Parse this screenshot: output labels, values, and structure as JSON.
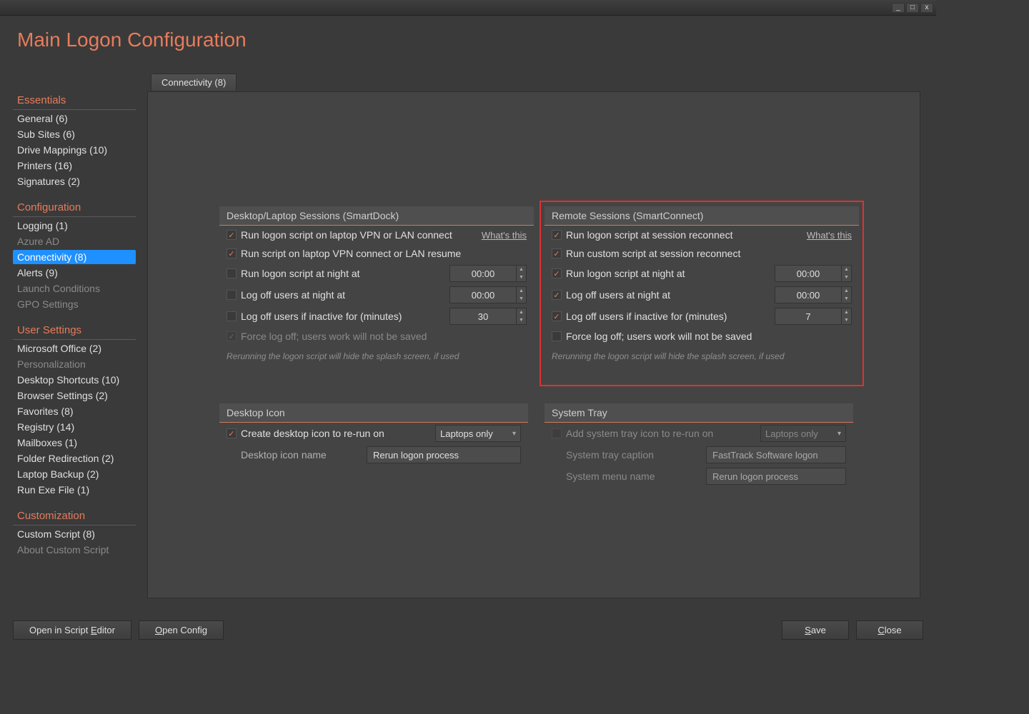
{
  "page_title": "Main Logon Configuration",
  "titlebar": {
    "min": "_",
    "max": "□",
    "close": "x"
  },
  "sidebar": {
    "sections": [
      {
        "title": "Essentials",
        "items": [
          {
            "label": "General (6)"
          },
          {
            "label": "Sub Sites (6)"
          },
          {
            "label": "Drive Mappings (10)"
          },
          {
            "label": "Printers (16)"
          },
          {
            "label": "Signatures (2)"
          }
        ]
      },
      {
        "title": "Configuration",
        "items": [
          {
            "label": "Logging (1)"
          },
          {
            "label": "Azure AD",
            "dim": true
          },
          {
            "label": "Connectivity (8)",
            "selected": true
          },
          {
            "label": "Alerts (9)"
          },
          {
            "label": "Launch Conditions",
            "dim": true
          },
          {
            "label": "GPO Settings",
            "dim": true
          }
        ]
      },
      {
        "title": "User Settings",
        "items": [
          {
            "label": "Microsoft Office (2)"
          },
          {
            "label": "Personalization",
            "dim": true
          },
          {
            "label": "Desktop Shortcuts (10)"
          },
          {
            "label": "Browser Settings (2)"
          },
          {
            "label": "Favorites (8)"
          },
          {
            "label": "Registry (14)"
          },
          {
            "label": "Mailboxes (1)"
          },
          {
            "label": "Folder Redirection (2)"
          },
          {
            "label": "Laptop Backup (2)"
          },
          {
            "label": "Run Exe File (1)"
          }
        ]
      },
      {
        "title": "Customization",
        "items": [
          {
            "label": "Custom Script (8)"
          },
          {
            "label": "About Custom Script",
            "dim": true
          }
        ]
      }
    ]
  },
  "tab_label": "Connectivity (8)",
  "groups": {
    "desktop": {
      "title": "Desktop/Laptop Sessions (SmartDock)",
      "whats_this": "What's this",
      "rows": {
        "r1": {
          "checked": true,
          "label": "Run logon script on laptop VPN or LAN connect"
        },
        "r2": {
          "checked": true,
          "label": "Run script on laptop VPN connect or LAN resume"
        },
        "r3": {
          "checked": false,
          "label": "Run logon script at night at",
          "value": "00:00"
        },
        "r4": {
          "checked": false,
          "label": "Log off users at night at",
          "value": "00:00"
        },
        "r5": {
          "checked": false,
          "label": "Log off users if inactive for (minutes)",
          "value": "30"
        },
        "r6": {
          "checked": true,
          "dim": true,
          "label": "Force log off; users work will not be saved"
        }
      },
      "hint": "Rerunning the logon script will hide the splash screen, if used"
    },
    "remote": {
      "title": "Remote Sessions (SmartConnect)",
      "whats_this": "What's this",
      "rows": {
        "r1": {
          "checked": true,
          "label": "Run logon script at session reconnect"
        },
        "r2": {
          "checked": true,
          "label": "Run custom script at session reconnect"
        },
        "r3": {
          "checked": true,
          "label": "Run logon script at night at",
          "value": "00:00"
        },
        "r4": {
          "checked": true,
          "label": "Log off users at night at",
          "value": "00:00"
        },
        "r5": {
          "checked": true,
          "label": "Log off users if inactive for (minutes)",
          "value": "7"
        },
        "r6": {
          "checked": false,
          "label": "Force log off; users work will not be saved"
        }
      },
      "hint": "Rerunning the logon script will hide the splash screen, if used"
    },
    "desktop_icon": {
      "title": "Desktop Icon",
      "r1": {
        "checked": true,
        "label": "Create desktop icon to re-run on",
        "dropdown": "Laptops only"
      },
      "r2": {
        "label": "Desktop icon name",
        "value": "Rerun logon process"
      }
    },
    "systray": {
      "title": "System Tray",
      "r1": {
        "checked": false,
        "dim": true,
        "label": "Add system tray icon to re-run on",
        "dropdown": "Laptops only"
      },
      "r2": {
        "dim": true,
        "label": "System tray caption",
        "value": "FastTrack Software logon"
      },
      "r3": {
        "dim": true,
        "label": "System menu name",
        "value": "Rerun logon process"
      }
    }
  },
  "footer": {
    "open_editor": "Open in Script Editor",
    "open_config": "Open Config",
    "save": "Save",
    "close": "Close"
  }
}
